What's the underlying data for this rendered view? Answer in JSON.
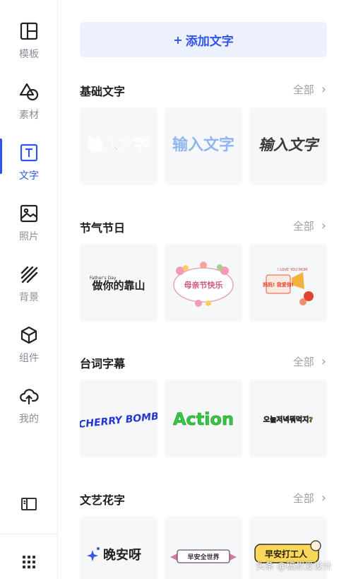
{
  "sidebar": {
    "items": [
      {
        "label": "模板",
        "icon": "template-icon"
      },
      {
        "label": "素材",
        "icon": "shapes-icon"
      },
      {
        "label": "文字",
        "icon": "text-icon"
      },
      {
        "label": "照片",
        "icon": "image-icon"
      },
      {
        "label": "背景",
        "icon": "background-hatch-icon"
      },
      {
        "label": "组件",
        "icon": "cube-icon"
      },
      {
        "label": "我的",
        "icon": "cloud-upload-icon"
      }
    ],
    "active_index": 2,
    "accent": "#2f54eb",
    "bottom_icons": [
      "panel-layout-icon",
      "grid-dots-icon"
    ]
  },
  "add_text_button": {
    "label": "添加文字",
    "icon": "plus"
  },
  "sections": [
    {
      "title": "基础文字",
      "all_label": "全部",
      "cards": [
        {
          "text": "输入文字",
          "style": "orange-gradient"
        },
        {
          "text": "输入文字",
          "style": "light-blue"
        },
        {
          "text": "输入文字",
          "style": "dark-brush"
        }
      ]
    },
    {
      "title": "节气节日",
      "all_label": "全部",
      "cards": [
        {
          "text": "做你的靠山",
          "subtext": "Father's Day",
          "style": "bold-dark"
        },
        {
          "text": "母亲节快乐",
          "style": "floral-frame"
        },
        {
          "text": "妈妈! 我爱你!",
          "subtext": "I LOVE YOU MOM",
          "style": "megaphone"
        }
      ]
    },
    {
      "title": "台词字幕",
      "all_label": "全部",
      "cards": [
        {
          "text": "CHERRY BOMB",
          "style": "blue-italic"
        },
        {
          "text": "Action",
          "style": "green-bold"
        },
        {
          "text": "오늘저녁뭐먹지?",
          "style": "yellow-outline"
        }
      ]
    },
    {
      "title": "文艺花字",
      "all_label": "全部",
      "cards": [
        {
          "text": "晚安呀",
          "style": "sparkle"
        },
        {
          "text": "早安全世界",
          "style": "ribbon"
        },
        {
          "text": "早安打工人",
          "style": "yellow-badge"
        }
      ]
    }
  ],
  "watermark": "头条 @稿叔爱设计"
}
